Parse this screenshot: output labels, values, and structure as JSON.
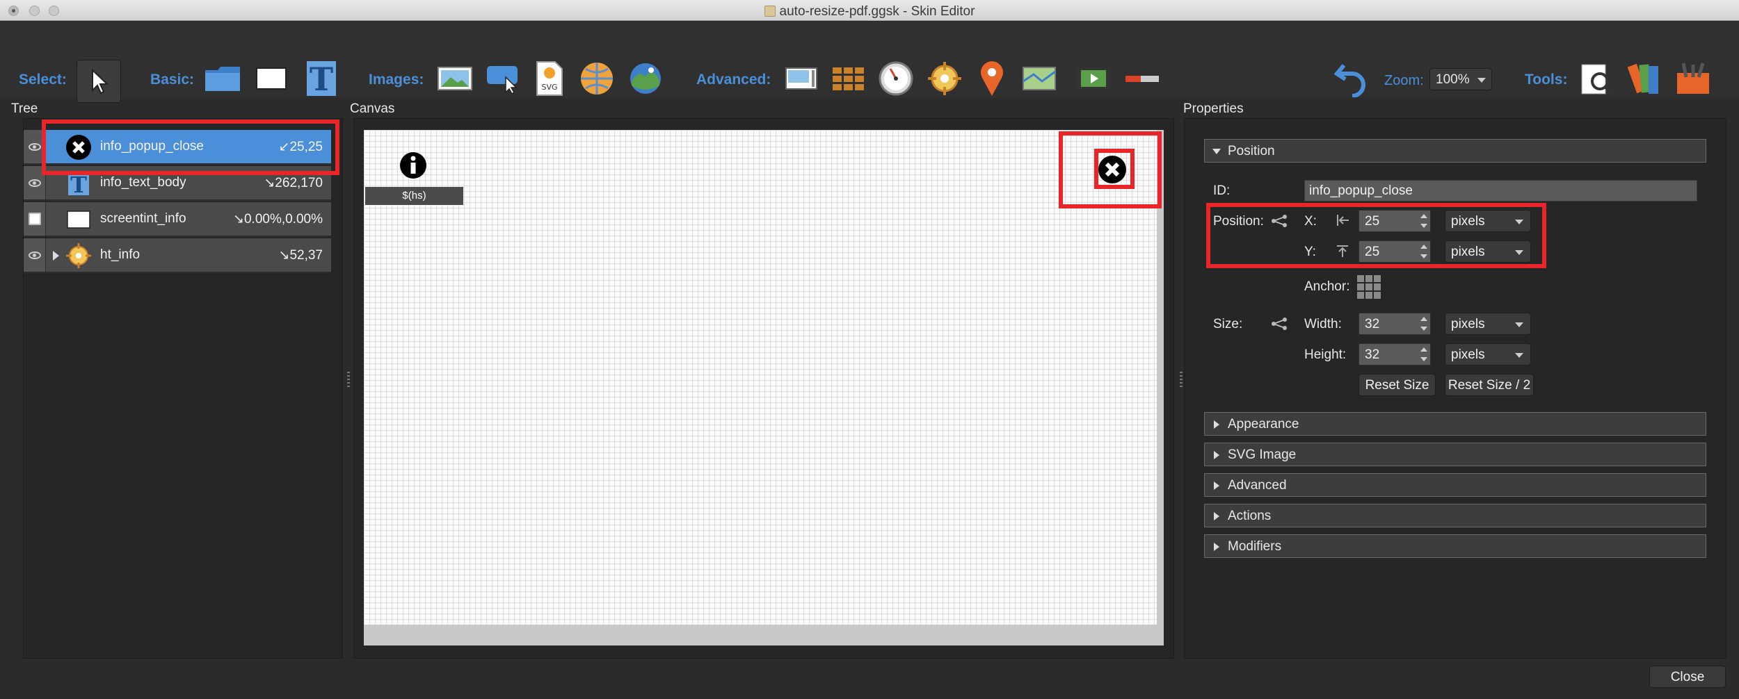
{
  "window": {
    "title": "auto-resize-pdf.ggsk - Skin Editor"
  },
  "toolbar": {
    "select_label": "Select:",
    "basic_label": "Basic:",
    "images_label": "Images:",
    "advanced_label": "Advanced:",
    "zoom_label": "Zoom:",
    "zoom_value": "100%",
    "tools_label": "Tools:",
    "svg_text": "SVG"
  },
  "panels": {
    "tree": "Tree",
    "canvas": "Canvas",
    "properties": "Properties"
  },
  "tree": {
    "items": [
      {
        "name": "info_popup_close",
        "pos": "↙25,25",
        "selected": true
      },
      {
        "name": "info_text_body",
        "pos": "↘262,170"
      },
      {
        "name": "screentint_info",
        "pos": "↘0.00%,0.00%"
      },
      {
        "name": "ht_info",
        "pos": "↘52,37"
      }
    ]
  },
  "canvas": {
    "hs_label": "$(hs)"
  },
  "properties": {
    "position_section": "Position",
    "id_label": "ID:",
    "id_value": "info_popup_close",
    "position_label": "Position:",
    "x_label": "X:",
    "x_value": "25",
    "x_unit": "pixels",
    "y_label": "Y:",
    "y_value": "25",
    "y_unit": "pixels",
    "anchor_label": "Anchor:",
    "size_label": "Size:",
    "width_label": "Width:",
    "width_value": "32",
    "width_unit": "pixels",
    "height_label": "Height:",
    "height_value": "32",
    "height_unit": "pixels",
    "reset_size": "Reset Size",
    "reset_size_half": "Reset Size / 2",
    "sections": [
      "Appearance",
      "SVG Image",
      "Advanced",
      "Actions",
      "Modifiers"
    ]
  },
  "footer": {
    "close_label": "Close"
  },
  "colors": {
    "accent": "#4a8fd8",
    "highlight": "#e8262a",
    "selected_row": "#4a8fd8"
  }
}
